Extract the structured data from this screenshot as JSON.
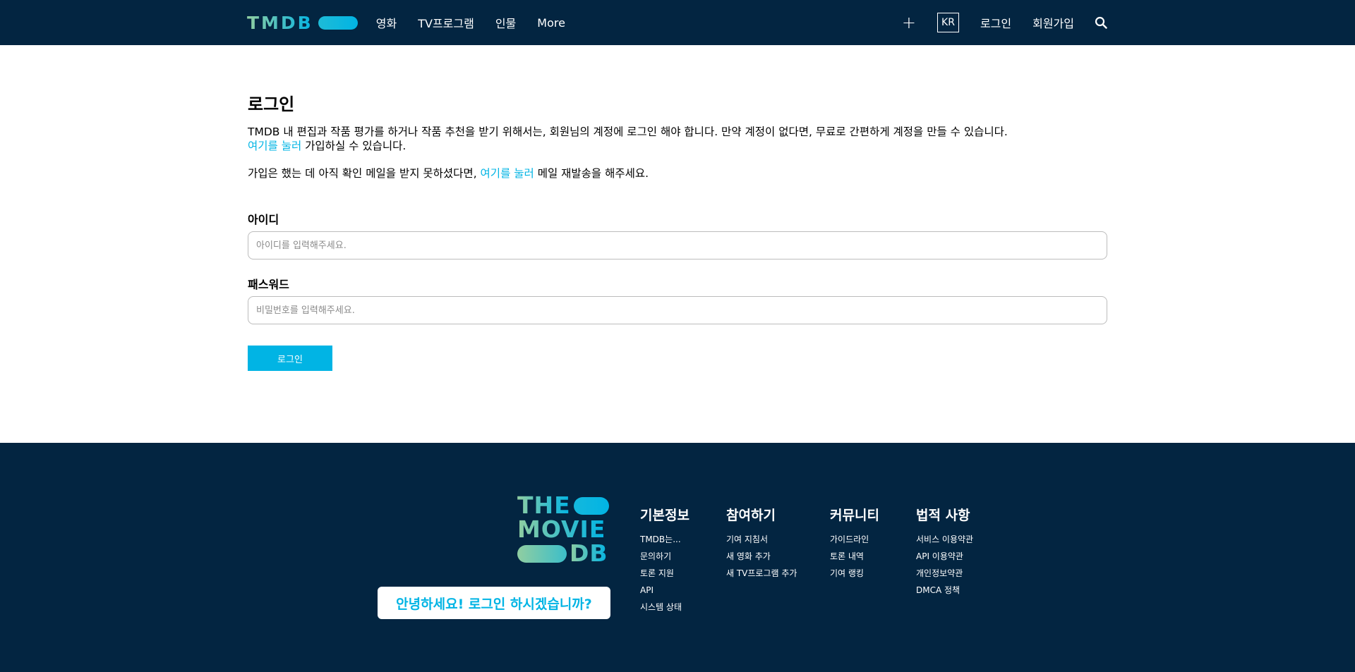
{
  "header": {
    "brand": "TMDB",
    "nav": [
      {
        "label": "영화"
      },
      {
        "label": "TV프로그램"
      },
      {
        "label": "인물"
      },
      {
        "label": "More"
      }
    ],
    "plus_label": "+",
    "language": "KR",
    "login": "로그인",
    "signup": "회원가입",
    "search_icon": "search-icon"
  },
  "main": {
    "title": "로그인",
    "desc1_text": "TMDB 내 편집과 작품 평가를 하거나 작품 추천을 받기 위해서는, 회원님의 계정에 로그인 해야 합니다. 만약 계정이 없다면, 무료로 간편하게 계정을 만들 수 있습니다.",
    "desc1_link": "여기를 눌러",
    "desc1_tail": " 가입하실 수 있습니다.",
    "desc2_text": "가입은 했는 데 아직 확인 메일을 받지 못하셨다면, ",
    "desc2_link": "여기를 눌러",
    "desc2_tail": " 메일 재발송을 해주세요.",
    "username_label": "아이디",
    "username_placeholder": "아이디를 입력해주세요.",
    "password_label": "패스워드",
    "password_placeholder": "비밀번호를 입력해주세요.",
    "login_button": "로그인",
    "link_color": "#01b4e4"
  },
  "footer": {
    "logo_lines": [
      "THE",
      "MOVIE",
      "DB"
    ],
    "greeting": "안녕하세요! 로그인 하시겠습니까?",
    "columns": [
      {
        "title": "기본정보",
        "items": [
          "TMDB는...",
          "문의하기",
          "토론 지원",
          "API",
          "시스템 상태"
        ]
      },
      {
        "title": "참여하기",
        "items": [
          "기여 지침서",
          "새 영화 추가",
          "새 TV프로그램 추가"
        ]
      },
      {
        "title": "커뮤니티",
        "items": [
          "가이드라인",
          "토론 내역",
          "기여 랭킹"
        ]
      },
      {
        "title": "법적 사항",
        "items": [
          "서비스 이용약관",
          "API 이용약관",
          "개인정보약관",
          "DMCA 정책"
        ]
      }
    ]
  },
  "colors": {
    "navy": "#032541",
    "accent": "#01b4e4",
    "green": "#90cea1"
  }
}
